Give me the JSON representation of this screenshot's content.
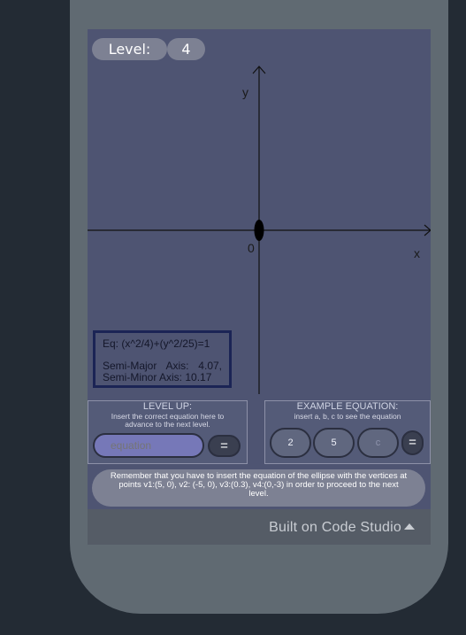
{
  "level": {
    "label": "Level:",
    "value": "4"
  },
  "graph": {
    "y_label": "y",
    "x_label": "x",
    "origin_label": "0"
  },
  "info": {
    "equation": "Eq: (x^2/4)+(y^2/25)=1",
    "axes_text": "Semi-Major Axis: 4.07, Semi-Minor Axis: 10.17"
  },
  "level_up": {
    "title": "LEVEL UP:",
    "subtitle": "Insert the correct equation here to advance to the next level.",
    "input_placeholder": "equation",
    "submit_label": "="
  },
  "example": {
    "title": "EXAMPLE EQUATION:",
    "subtitle": "insert a, b, c to see the equation",
    "a_value": "2",
    "b_value": "5",
    "c_placeholder": "c",
    "submit_label": "="
  },
  "reminder": "Remember that you have to insert the equation of the ellipse with the vertices at points v1:(5, 0), v2: (-5, 0), v3:(0.3), v4:(0,-3) in order to proceed to the next level.",
  "footer": {
    "label": "Built on Code Studio"
  },
  "colors": {
    "screen": "#4e5472",
    "pill": "#7d8193",
    "input": "#7678b8",
    "frame": "#606a72"
  }
}
